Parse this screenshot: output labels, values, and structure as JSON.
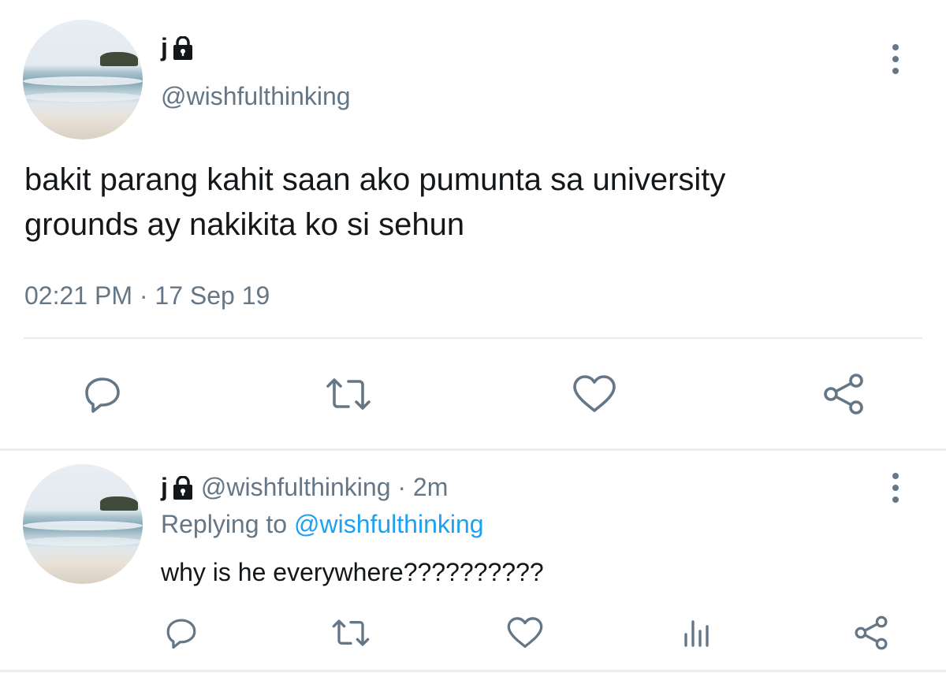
{
  "tweet": {
    "display_name": "j",
    "handle": "@wishfulthinking",
    "text_line1": "bakit parang kahit saan ako pumunta sa university",
    "text_line2": "grounds ay nakikita ko si sehun",
    "timestamp": "02:21 PM · 17 Sep 19",
    "icons": {
      "reply": "reply-icon",
      "retweet": "retweet-icon",
      "like": "like-heart-icon",
      "share": "share-icon",
      "lock": "lock-icon",
      "more": "more-options-icon"
    }
  },
  "reply": {
    "display_name": "j",
    "handle": "@wishfulthinking",
    "separator": " · ",
    "time_ago": "2m",
    "replying_prefix": "Replying to ",
    "replying_to": "@wishfulthinking",
    "text": "why is he everywhere??????????",
    "icons": {
      "reply": "reply-icon",
      "retweet": "retweet-icon",
      "like": "like-heart-icon",
      "analytics": "analytics-icon",
      "share": "share-icon"
    }
  },
  "colors": {
    "text": "#14171a",
    "muted": "#657786",
    "link": "#1da1f2",
    "divider": "#e6ecf0"
  }
}
